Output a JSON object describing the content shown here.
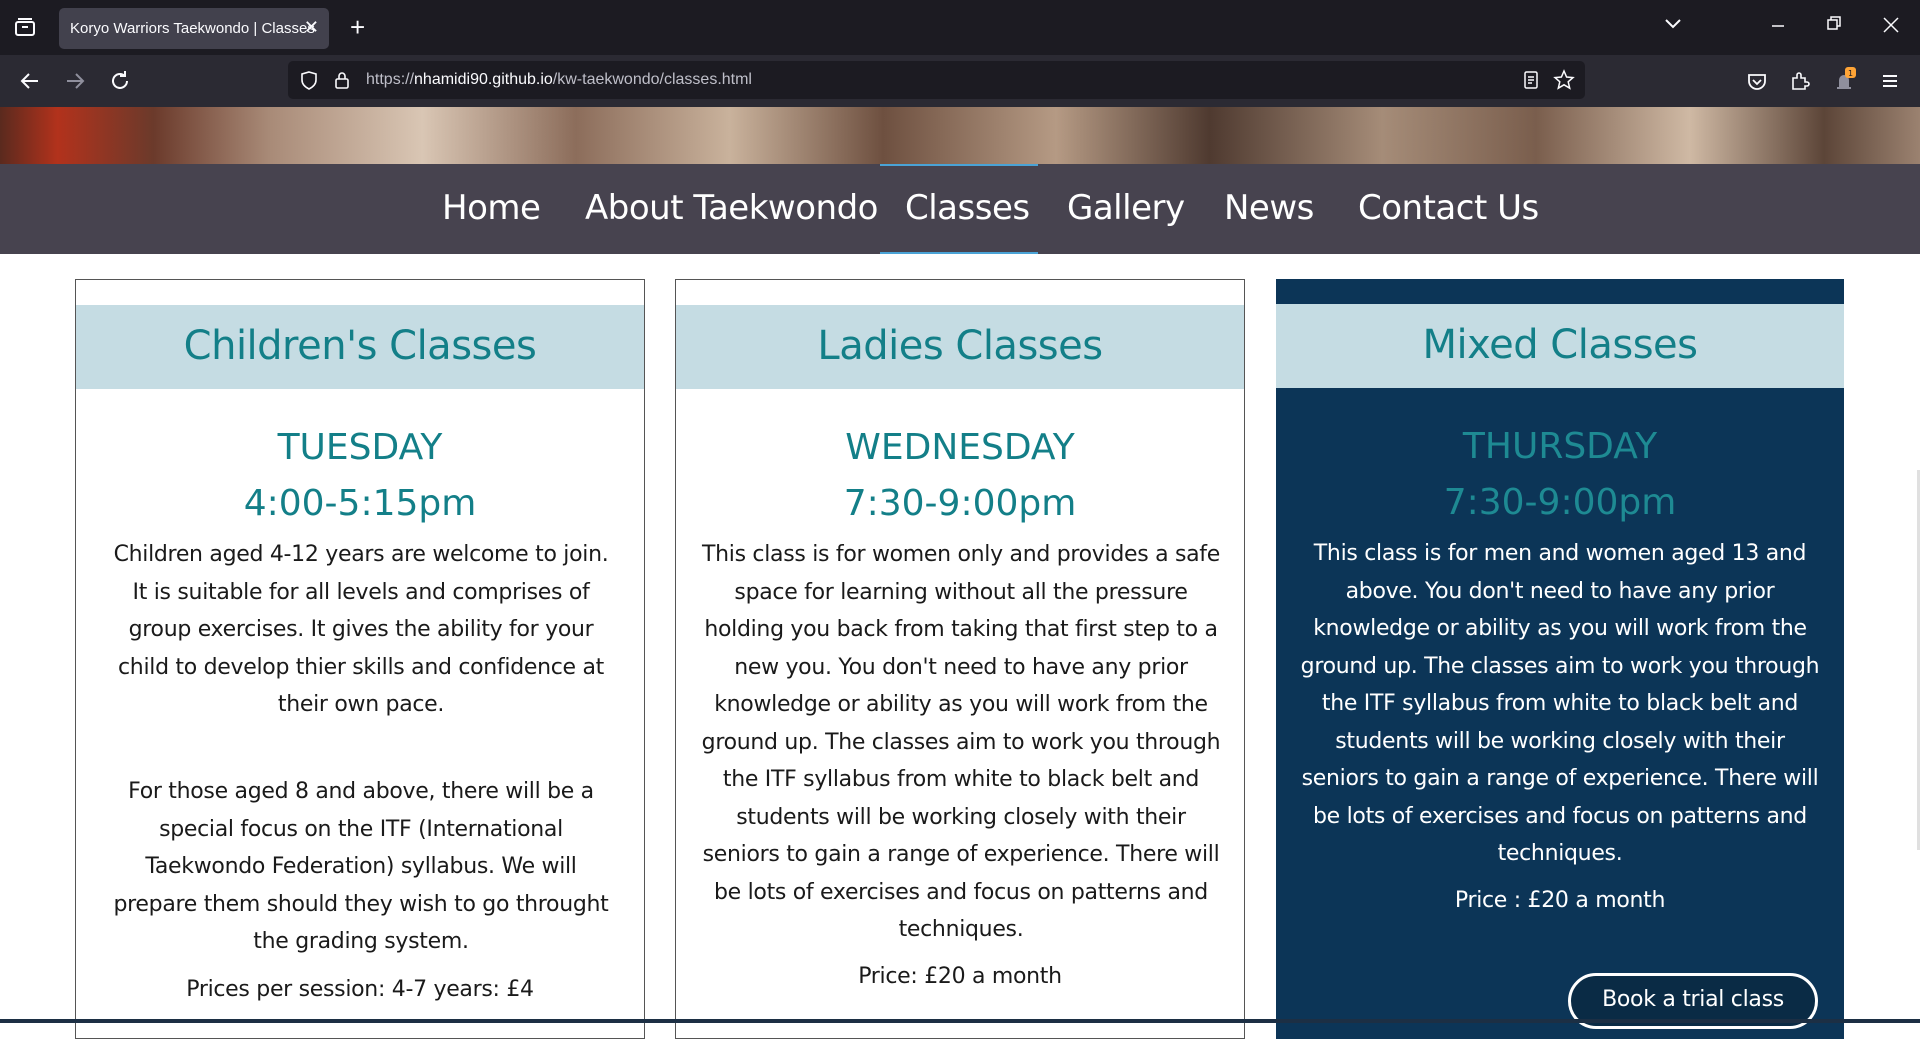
{
  "browser": {
    "tab_title": "Koryo Warriors Taekwondo | Classes",
    "url_prefix": "https://",
    "url_host": "nhamidi90.github.io",
    "url_path": "/kw-taekwondo/classes.html"
  },
  "nav": {
    "items": [
      "Home",
      "About Taekwondo",
      "Classes",
      "Gallery",
      "News",
      "Contact Us"
    ],
    "active": "Classes"
  },
  "cards": [
    {
      "title": "Children's Classes",
      "day": "TUESDAY",
      "time": "4:00-5:15pm",
      "para1": "Children aged 4-12 years are welcome to join. It is suitable for all levels and comprises of group exercises. It gives the ability for your child to develop thier skills and confidence at their own pace.",
      "para2": "For those aged 8 and above, there will be a special focus on the ITF (International Taekwondo Federation) syllabus. We will prepare them should they wish to go throught the grading system.",
      "price": "Prices per session: 4-7 years: £4"
    },
    {
      "title": "Ladies Classes",
      "day": "WEDNESDAY",
      "time": "7:30-9:00pm",
      "para1": "This class is for women only and provides a safe space for learning without all the pressure holding you back from taking that first step to a new you. You don't need to have any prior knowledge or ability as you will work from the ground up. The classes aim to work you through the ITF syllabus from white to black belt and students will be working closely with their seniors to gain a range of experience. There will be lots of exercises and focus on patterns and techniques.",
      "price": "Price: £20 a month"
    },
    {
      "title": "Mixed Classes",
      "day": "THURSDAY",
      "time": "7:30-9:00pm",
      "para1": "This class is for men and women aged 13 and above. You don't need to have any prior knowledge or ability as you will work from the ground up. The classes aim to work you through the ITF syllabus from white to black belt and students will be working closely with their seniors to gain a range of experience. There will be lots of exercises and focus on patterns and techniques.",
      "price": "Price : £20 a month",
      "button": "Book a trial class"
    }
  ],
  "colors": {
    "nav_bg": "#47434f",
    "title_teal": "#137f88",
    "card_header_bg": "#c5dce3",
    "dark_card_bg": "#0c3557",
    "active_underline": "#4aa3d6"
  }
}
